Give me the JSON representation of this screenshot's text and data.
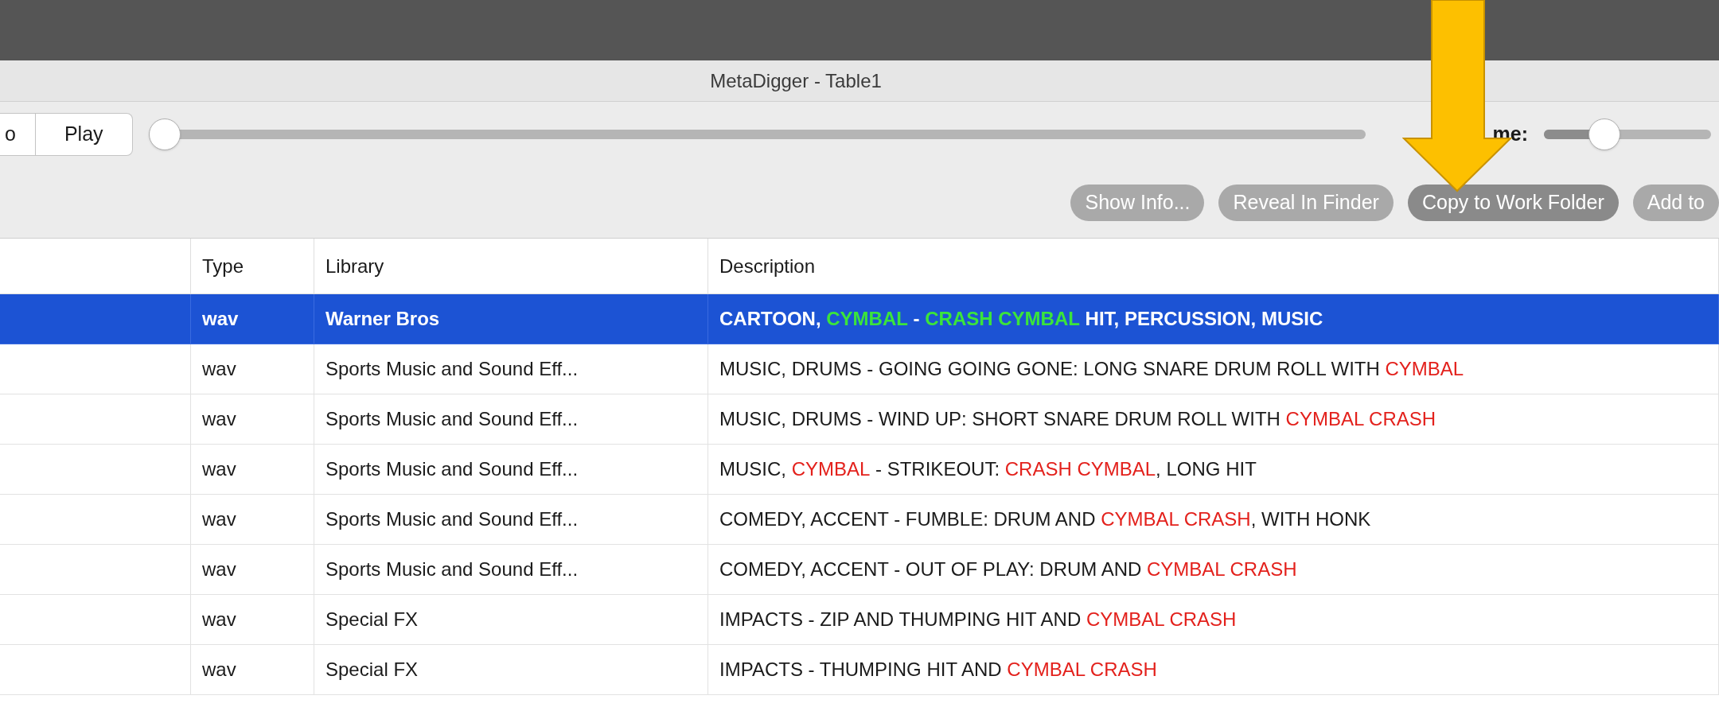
{
  "window": {
    "title": "MetaDigger - Table1"
  },
  "transport": {
    "buttons": [
      {
        "label": "o"
      },
      {
        "label": "Play"
      }
    ],
    "position": {
      "level": 0
    },
    "volume": {
      "label": "me:",
      "level": 0.33
    }
  },
  "actions": [
    {
      "label": "Show Info...",
      "selected": false
    },
    {
      "label": "Reveal In Finder",
      "selected": false
    },
    {
      "label": "Copy to Work Folder",
      "selected": true
    },
    {
      "label": "Add to",
      "selected": false
    }
  ],
  "table": {
    "columns": [
      "Type",
      "Library",
      "Description"
    ],
    "rows": [
      {
        "selected": true,
        "type": "wav",
        "library": "Warner Bros",
        "description": [
          {
            "text": "CARTOON, ",
            "match": false
          },
          {
            "text": "CYMBAL",
            "match": true
          },
          {
            "text": " - ",
            "match": false
          },
          {
            "text": "CRASH CYMBAL",
            "match": true
          },
          {
            "text": " HIT, PERCUSSION, MUSIC",
            "match": false
          }
        ]
      },
      {
        "selected": false,
        "type": "wav",
        "library": "Sports Music and Sound Eff...",
        "description": [
          {
            "text": "MUSIC, DRUMS - GOING GOING GONE: LONG SNARE DRUM ROLL WITH ",
            "match": false
          },
          {
            "text": "CYMBAL",
            "match": true
          }
        ]
      },
      {
        "selected": false,
        "type": "wav",
        "library": "Sports Music and Sound Eff...",
        "description": [
          {
            "text": "MUSIC, DRUMS - WIND UP: SHORT SNARE DRUM ROLL WITH ",
            "match": false
          },
          {
            "text": "CYMBAL CRASH",
            "match": true
          }
        ]
      },
      {
        "selected": false,
        "type": "wav",
        "library": "Sports Music and Sound Eff...",
        "description": [
          {
            "text": "MUSIC, ",
            "match": false
          },
          {
            "text": "CYMBAL",
            "match": true
          },
          {
            "text": " - STRIKEOUT: ",
            "match": false
          },
          {
            "text": "CRASH CYMBAL",
            "match": true
          },
          {
            "text": ", LONG HIT",
            "match": false
          }
        ]
      },
      {
        "selected": false,
        "type": "wav",
        "library": "Sports Music and Sound Eff...",
        "description": [
          {
            "text": "COMEDY, ACCENT - FUMBLE: DRUM AND ",
            "match": false
          },
          {
            "text": "CYMBAL CRASH",
            "match": true
          },
          {
            "text": ", WITH HONK",
            "match": false
          }
        ]
      },
      {
        "selected": false,
        "type": "wav",
        "library": "Sports Music and Sound Eff...",
        "description": [
          {
            "text": "COMEDY, ACCENT - OUT OF PLAY: DRUM AND ",
            "match": false
          },
          {
            "text": "CYMBAL CRASH",
            "match": true
          }
        ]
      },
      {
        "selected": false,
        "type": "wav",
        "library": "Special FX",
        "description": [
          {
            "text": "IMPACTS - ZIP AND THUMPING HIT AND ",
            "match": false
          },
          {
            "text": "CYMBAL CRASH",
            "match": true
          }
        ]
      },
      {
        "selected": false,
        "type": "wav",
        "library": "Special FX",
        "description": [
          {
            "text": "IMPACTS - THUMPING HIT AND ",
            "match": false
          },
          {
            "text": "CYMBAL CRASH",
            "match": true
          }
        ]
      }
    ]
  }
}
